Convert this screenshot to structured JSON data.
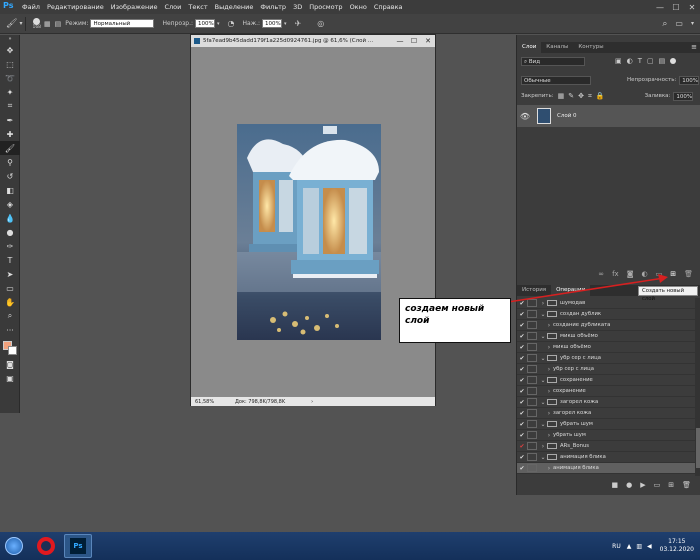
{
  "menubar": {
    "logo": "Ps",
    "items": [
      "Файл",
      "Редактирование",
      "Изображение",
      "Слои",
      "Текст",
      "Выделение",
      "Фильтр",
      "3D",
      "Просмотр",
      "Окно",
      "Справка"
    ],
    "controls": [
      "—",
      "☐",
      "✕"
    ]
  },
  "options": {
    "brush_size": "168",
    "mode_label": "Режим:",
    "mode_value": "Нормальный",
    "opacity_label": "Непрозр.:",
    "opacity_value": "100%",
    "flow_label": "Наж.:",
    "flow_value": "100%"
  },
  "document": {
    "title": "5fa7ead9b45dadd179f1a225d0924761.jpg @ 61,6% (Слой ...",
    "zoom": "61,58%",
    "doc_info": "Док: 798,8K/798,8K"
  },
  "layers_panel": {
    "tabs": [
      "Слои",
      "Каналы",
      "Контуры"
    ],
    "search": "Вид",
    "blend_mode": "Обычные",
    "opacity_label": "Непрозрачность:",
    "opacity_value": "100%",
    "lock_label": "Закрепить:",
    "fill_label": "Заливка:",
    "fill_value": "100%",
    "layer_name": "Слой 0"
  },
  "history_panel": {
    "tabs": [
      "История",
      "Операции"
    ],
    "rows": [
      {
        "label": "шумодав",
        "kind": "set"
      },
      {
        "label": "создан дублик",
        "kind": "set",
        "open": true
      },
      {
        "label": "создание дубликата",
        "kind": "step"
      },
      {
        "label": "микш объёмо",
        "kind": "set",
        "open": true
      },
      {
        "label": "микш объёмо",
        "kind": "step"
      },
      {
        "label": "убр сер с лица",
        "kind": "set",
        "open": true
      },
      {
        "label": "убр сер с лица",
        "kind": "step"
      },
      {
        "label": "сохранение",
        "kind": "set",
        "open": true
      },
      {
        "label": "сохранение",
        "kind": "step"
      },
      {
        "label": "загорел кожа",
        "kind": "set",
        "open": true
      },
      {
        "label": "загорел кожа",
        "kind": "step"
      },
      {
        "label": "убрать шум",
        "kind": "set",
        "open": true
      },
      {
        "label": "убрать шум",
        "kind": "step"
      },
      {
        "label": "ARs_Bonus",
        "kind": "set",
        "red": true
      },
      {
        "label": "анимация блика",
        "kind": "set",
        "open": true
      },
      {
        "label": "анимация блика",
        "kind": "step",
        "selected": true
      }
    ]
  },
  "tooltip": "Создать новый слой",
  "callout": "создаем новый слой",
  "taskbar": {
    "lang": "RU",
    "time": "17:15",
    "date": "03.12.2020",
    "ps_label": "Ps"
  },
  "colors": {
    "ps_blue": "#31a8ff",
    "fg_swatch": "#f2a27d",
    "arrow": "#d62020"
  }
}
